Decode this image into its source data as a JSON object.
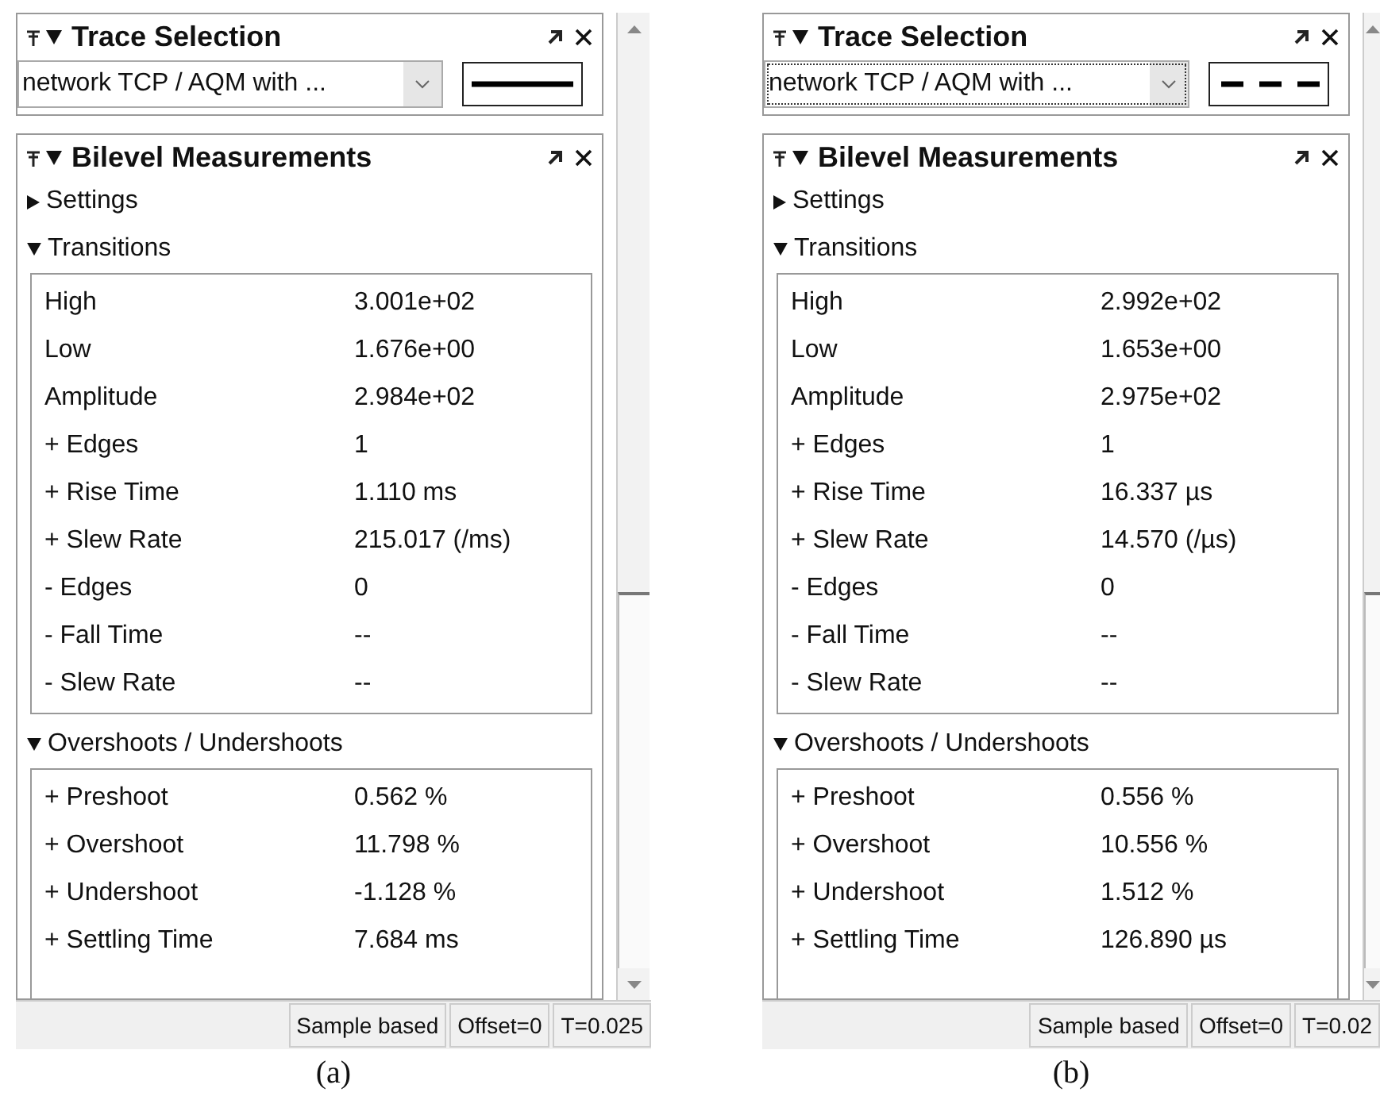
{
  "figures": [
    {
      "caption": "(a)",
      "trace": {
        "title": "Trace Selection",
        "combo_value": "network TCP / AQM with ...",
        "focused": false,
        "dashed": false
      },
      "measurements": {
        "title": "Bilevel Measurements",
        "sections": [
          {
            "label": "Settings",
            "expanded": false
          },
          {
            "label": "Transitions",
            "expanded": true,
            "rows": [
              {
                "name": "High",
                "value": "3.001e+02"
              },
              {
                "name": "Low",
                "value": "1.676e+00"
              },
              {
                "name": "Amplitude",
                "value": "2.984e+02"
              },
              {
                "name": "+ Edges",
                "value": "1"
              },
              {
                "name": "+ Rise Time",
                "value": "1.110 ms"
              },
              {
                "name": "+ Slew Rate",
                "value": "215.017 (/ms)"
              },
              {
                "name": "- Edges",
                "value": "0"
              },
              {
                "name": "- Fall Time",
                "value": "--"
              },
              {
                "name": "- Slew Rate",
                "value": "--"
              }
            ]
          },
          {
            "label": "Overshoots / Undershoots",
            "expanded": true,
            "rows": [
              {
                "name": "+ Preshoot",
                "value": "0.562 %"
              },
              {
                "name": "+ Overshoot",
                "value": "11.798 %"
              },
              {
                "name": "+ Undershoot",
                "value": "-1.128 %"
              },
              {
                "name": "+ Settling Time",
                "value": "7.684 ms"
              }
            ]
          }
        ]
      },
      "status": [
        "Sample based",
        "Offset=0",
        "T=0.025"
      ]
    },
    {
      "caption": "(b)",
      "trace": {
        "title": "Trace Selection",
        "combo_value": "network TCP / AQM with ...",
        "focused": true,
        "dashed": true
      },
      "measurements": {
        "title": "Bilevel Measurements",
        "sections": [
          {
            "label": "Settings",
            "expanded": false
          },
          {
            "label": "Transitions",
            "expanded": true,
            "rows": [
              {
                "name": "High",
                "value": "2.992e+02"
              },
              {
                "name": "Low",
                "value": "1.653e+00"
              },
              {
                "name": "Amplitude",
                "value": "2.975e+02"
              },
              {
                "name": "+ Edges",
                "value": "1"
              },
              {
                "name": "+ Rise Time",
                "value": "16.337 µs"
              },
              {
                "name": "+ Slew Rate",
                "value": "14.570 (/µs)"
              },
              {
                "name": "- Edges",
                "value": "0"
              },
              {
                "name": "- Fall Time",
                "value": "--"
              },
              {
                "name": "- Slew Rate",
                "value": "--"
              }
            ]
          },
          {
            "label": "Overshoots / Undershoots",
            "expanded": true,
            "rows": [
              {
                "name": "+ Preshoot",
                "value": "0.556 %"
              },
              {
                "name": "+ Overshoot",
                "value": "10.556 %"
              },
              {
                "name": "+ Undershoot",
                "value": "1.512 %"
              },
              {
                "name": "+ Settling Time",
                "value": "126.890 µs"
              }
            ]
          }
        ]
      },
      "status": [
        "Sample based",
        "Offset=0",
        "T=0.02"
      ]
    }
  ]
}
